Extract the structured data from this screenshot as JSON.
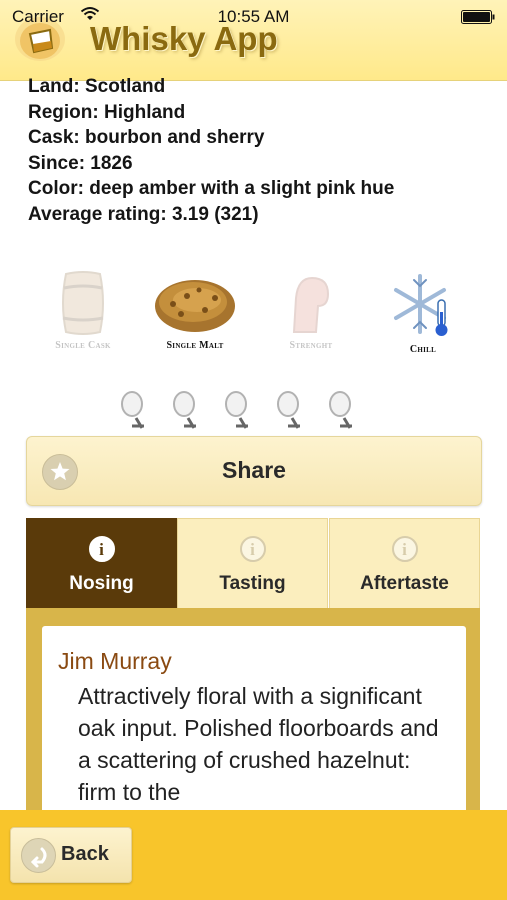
{
  "status": {
    "carrier": "Carrier",
    "time": "10:55 AM"
  },
  "header": {
    "title": "Whisky App",
    "logo_icon": "whisky-glass-logo"
  },
  "info": [
    "Land: Scotland",
    "Region: Highland",
    "Cask: bourbon and sherry",
    "Since: 1826",
    "Color: deep amber with a slight pink hue",
    "Average rating: 3.19 (321)"
  ],
  "features": [
    {
      "label": "Single Cask",
      "icon": "barrel-icon",
      "active": false
    },
    {
      "label": "Single Malt",
      "icon": "malt-grain-icon",
      "active": true
    },
    {
      "label": "Strenght",
      "icon": "arm-muscle-icon",
      "active": false
    },
    {
      "label": "Chill",
      "icon": "snowflake-thermometer-icon",
      "active": true
    }
  ],
  "rating_icons": {
    "count": 5,
    "icon": "tasting-glass-icon"
  },
  "share": {
    "label": "Share",
    "icon": "star-icon"
  },
  "tabs": [
    {
      "label": "Nosing",
      "active": true
    },
    {
      "label": "Tasting",
      "active": false
    },
    {
      "label": "Aftertaste",
      "active": false
    }
  ],
  "content": {
    "author": "Jim Murray",
    "text": "Attractively floral with a significant oak input. Polished floorboards and a scattering of crushed hazelnut: firm to the"
  },
  "footer": {
    "back_label": "Back",
    "back_icon": "back-arrow-icon"
  },
  "colors": {
    "header": "#ffe98a",
    "tab_active": "#5a3a0a",
    "frame": "#d8b54a",
    "bottom_bar": "#f8c52b",
    "author": "#8a4a12"
  }
}
